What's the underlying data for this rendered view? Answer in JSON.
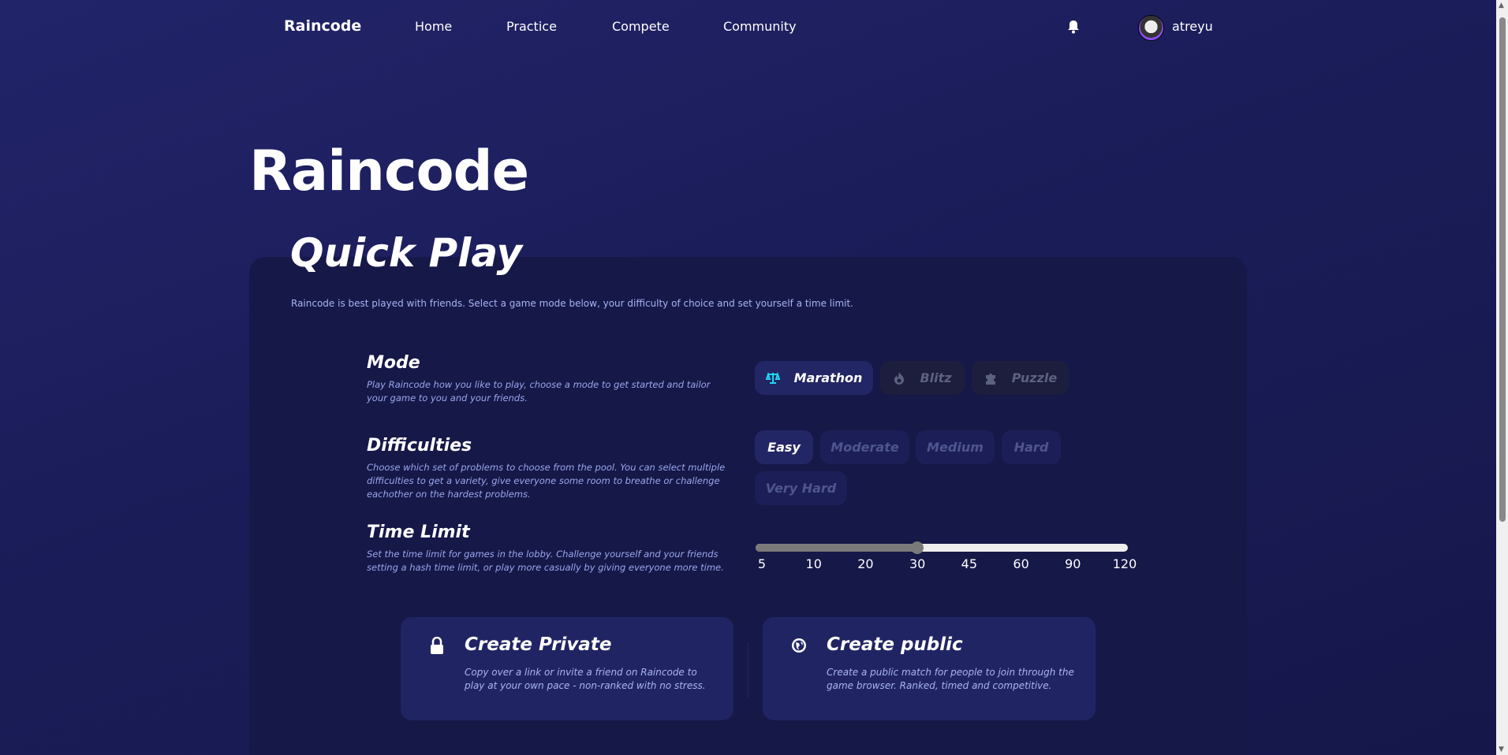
{
  "nav": {
    "logo": "Raincode",
    "links": [
      "Home",
      "Practice",
      "Compete",
      "Community"
    ],
    "username": "atreyu"
  },
  "hero": {
    "title": "Raincode"
  },
  "quick_play": {
    "title": "Quick Play",
    "description": "Raincode is best played with friends. Select a game mode below, your difficulty of choice and set yourself a time limit."
  },
  "mode": {
    "heading": "Mode",
    "description": "Play Raincode how you like to play, choose a mode to get started and tailor your game to you and your friends.",
    "options": [
      {
        "label": "Marathon",
        "icon": "scale-icon",
        "selected": true
      },
      {
        "label": "Blitz",
        "icon": "fire-icon",
        "selected": false
      },
      {
        "label": "Puzzle",
        "icon": "puzzle-icon",
        "selected": false
      }
    ]
  },
  "difficulties": {
    "heading": "Difficulties",
    "description": "Choose which set of problems to choose from the pool. You can select multiple difficulties to get a variety, give everyone some room to breathe or challenge eachother on the hardest problems.",
    "options": [
      {
        "label": "Easy",
        "selected": true
      },
      {
        "label": "Moderate",
        "selected": false
      },
      {
        "label": "Medium",
        "selected": false
      },
      {
        "label": "Hard",
        "selected": false
      },
      {
        "label": "Very Hard",
        "selected": false
      }
    ]
  },
  "time_limit": {
    "heading": "Time Limit",
    "description": "Set the time limit for games in the lobby. Challenge yourself and your friends setting a hash time limit, or play more casually by giving everyone more time.",
    "ticks": [
      "5",
      "10",
      "20",
      "30",
      "45",
      "60",
      "90",
      "120"
    ],
    "selected_index": 3
  },
  "cards": {
    "private": {
      "title": "Create Private",
      "description": "Copy over a link or invite a friend on Raincode to play at your own pace - non-ranked with no stress."
    },
    "public": {
      "title": "Create public",
      "description": "Create a public match for people to join through the game browser. Ranked, timed and competitive."
    }
  },
  "colors": {
    "accent_icon": "#1ad8f0",
    "panel": "#161848",
    "card": "#212463"
  }
}
